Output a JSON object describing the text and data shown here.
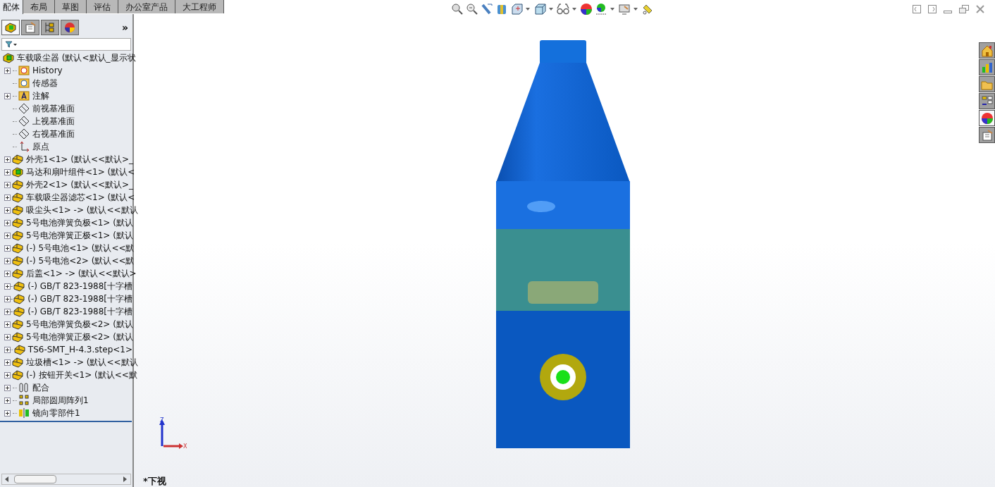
{
  "tabs": [
    {
      "label": "配体",
      "selected": true
    },
    {
      "label": "布局",
      "selected": false
    },
    {
      "label": "草图",
      "selected": false
    },
    {
      "label": "评估",
      "selected": false
    },
    {
      "label": "办公室产品",
      "selected": false
    },
    {
      "label": "大工程师",
      "selected": false
    }
  ],
  "panel_tabs": [
    {
      "kind": "tree",
      "selected": true
    },
    {
      "kind": "property",
      "selected": false
    },
    {
      "kind": "config",
      "selected": false
    },
    {
      "kind": "display",
      "selected": false
    }
  ],
  "panel_more": "»",
  "tree": {
    "label": "车载吸尘器  (默认<默认_显示状",
    "kind": "assembly",
    "children": [
      {
        "label": "History",
        "kind": "history",
        "expandable": true
      },
      {
        "label": "传感器",
        "kind": "sensor",
        "expandable": false
      },
      {
        "label": "注解",
        "kind": "annotation",
        "expandable": true
      },
      {
        "label": "前视基准面",
        "kind": "plane",
        "expandable": false
      },
      {
        "label": "上视基准面",
        "kind": "plane",
        "expandable": false
      },
      {
        "label": "右视基准面",
        "kind": "plane",
        "expandable": false
      },
      {
        "label": "原点",
        "kind": "origin",
        "expandable": false
      },
      {
        "label": "外壳1<1> (默认<<默认>_",
        "kind": "part",
        "expandable": true
      },
      {
        "label": "马达和扇叶组件<1> (默认<",
        "kind": "subassembly",
        "expandable": true
      },
      {
        "label": "外壳2<1> (默认<<默认>_",
        "kind": "part",
        "expandable": true
      },
      {
        "label": "车载吸尘器滤芯<1> (默认<",
        "kind": "part",
        "expandable": true
      },
      {
        "label": "吸尘头<1> -> (默认<<默认",
        "kind": "part",
        "expandable": true
      },
      {
        "label": "5号电池弹簧负极<1> (默认",
        "kind": "part",
        "expandable": true
      },
      {
        "label": "5号电池弹簧正极<1> (默认",
        "kind": "part",
        "expandable": true
      },
      {
        "label": "(-) 5号电池<1> (默认<<默",
        "kind": "part",
        "expandable": true
      },
      {
        "label": "(-) 5号电池<2> (默认<<默",
        "kind": "part",
        "expandable": true
      },
      {
        "label": "后盖<1> -> (默认<<默认>",
        "kind": "part",
        "expandable": true
      },
      {
        "label": "(-) GB/T 823-1988[十字槽",
        "kind": "part",
        "expandable": true
      },
      {
        "label": "(-) GB/T 823-1988[十字槽",
        "kind": "part",
        "expandable": true
      },
      {
        "label": "(-) GB/T 823-1988[十字槽",
        "kind": "part",
        "expandable": true
      },
      {
        "label": "5号电池弹簧负极<2> (默认",
        "kind": "part",
        "expandable": true
      },
      {
        "label": "5号电池弹簧正极<2> (默认",
        "kind": "part",
        "expandable": true
      },
      {
        "label": "TS6-SMT_H-4.3.step<1>",
        "kind": "part",
        "expandable": true
      },
      {
        "label": "垃圾槽<1> -> (默认<<默认",
        "kind": "part",
        "expandable": true
      },
      {
        "label": "(-) 按钮开关<1> (默认<<默",
        "kind": "part",
        "expandable": true
      },
      {
        "label": "配合",
        "kind": "mates",
        "expandable": true
      },
      {
        "label": "局部圆周阵列1",
        "kind": "pattern",
        "expandable": true
      },
      {
        "label": "镜向零部件1",
        "kind": "mirror",
        "expandable": true
      }
    ]
  },
  "view_toolbar": [
    {
      "kind": "zoom-fit",
      "dropdown": false
    },
    {
      "kind": "zoom-area",
      "dropdown": false
    },
    {
      "kind": "previous",
      "dropdown": false
    },
    {
      "kind": "section",
      "dropdown": false
    },
    {
      "kind": "orientation",
      "dropdown": true
    },
    {
      "kind": "display-style",
      "dropdown": true
    },
    {
      "kind": "hide-show",
      "dropdown": true
    },
    {
      "kind": "appearance",
      "dropdown": false
    },
    {
      "kind": "scene",
      "dropdown": true
    },
    {
      "kind": "view-settings",
      "dropdown": true
    },
    {
      "kind": "render",
      "dropdown": false
    }
  ],
  "triad": {
    "z": "Z",
    "x": "X"
  },
  "view_name": "*下视",
  "task_pane": [
    {
      "kind": "home",
      "selected": false
    },
    {
      "kind": "library",
      "selected": false
    },
    {
      "kind": "folder",
      "selected": false
    },
    {
      "kind": "palette",
      "selected": false
    },
    {
      "kind": "appearance",
      "selected": true
    },
    {
      "kind": "properties",
      "selected": false
    }
  ]
}
